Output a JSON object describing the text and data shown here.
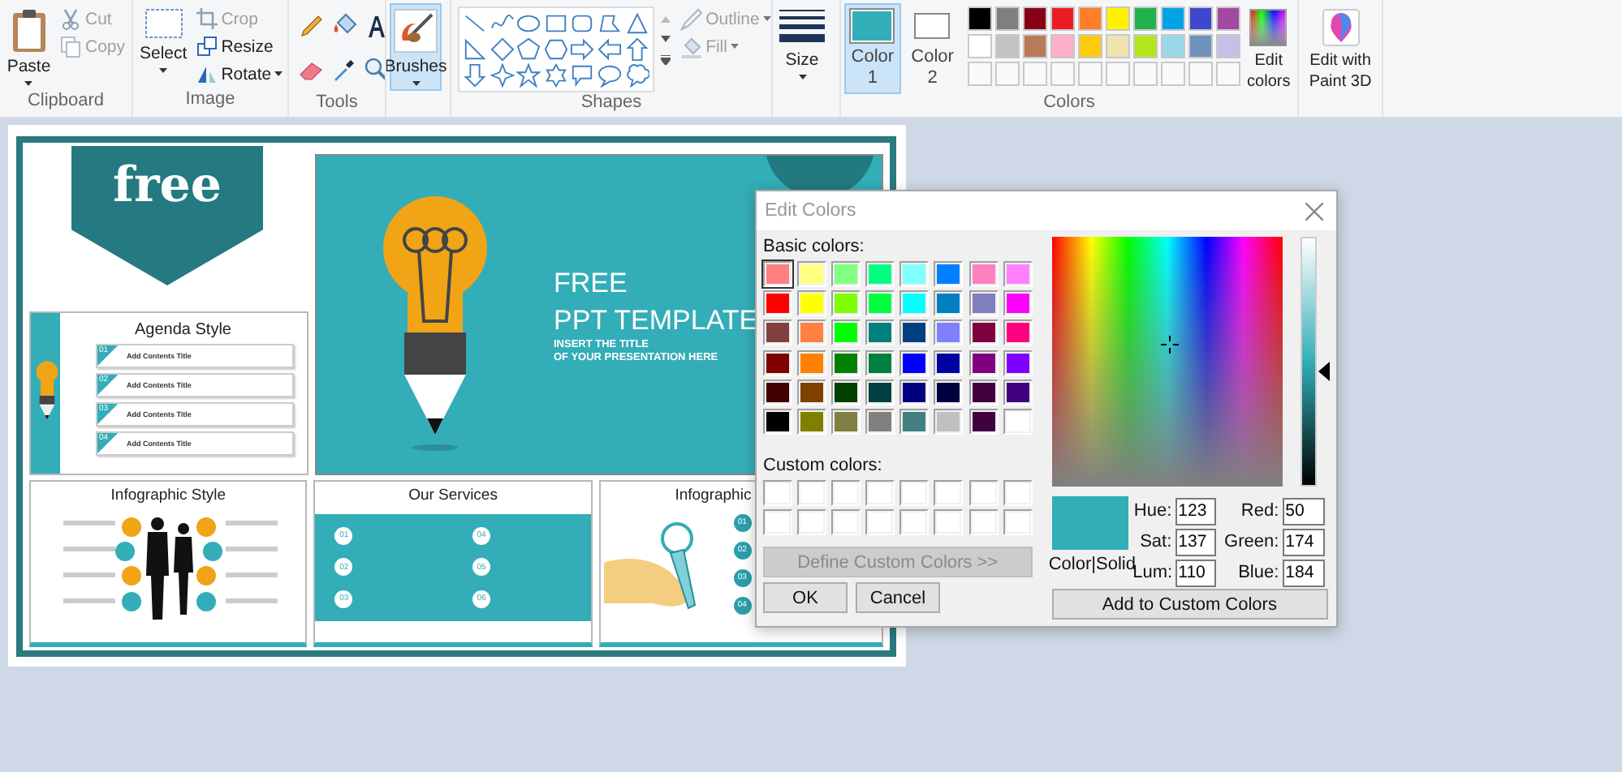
{
  "clipboard": {
    "paste": "Paste",
    "cut": {
      "label": "Cut",
      "disabled": true
    },
    "copy": {
      "label": "Copy",
      "disabled": true
    },
    "group_label": "Clipboard"
  },
  "image": {
    "select": "Select",
    "crop": {
      "label": "Crop",
      "disabled": true
    },
    "resize": {
      "label": "Resize",
      "disabled": false
    },
    "rotate": {
      "label": "Rotate",
      "disabled": false
    },
    "group_label": "Image"
  },
  "tools": {
    "group_label": "Tools"
  },
  "brushes": {
    "label": "Brushes",
    "selected": true
  },
  "shapes": {
    "outline": {
      "label": "Outline",
      "disabled": true
    },
    "fill": {
      "label": "Fill",
      "disabled": true
    },
    "group_label": "Shapes"
  },
  "size": {
    "label": "Size"
  },
  "colors": {
    "color1": {
      "label": "Color",
      "sub": "1",
      "color": "#32aeb8",
      "selected": true
    },
    "color2": {
      "label": "Color",
      "sub": "2",
      "color": "#ffffff",
      "selected": false
    },
    "palette": [
      {
        "color": "#000000"
      },
      {
        "color": "#7f7f7f"
      },
      {
        "color": "#880015"
      },
      {
        "color": "#ed1c24"
      },
      {
        "color": "#ff7f27"
      },
      {
        "color": "#fff200"
      },
      {
        "color": "#22b14c"
      },
      {
        "color": "#00a2e8"
      },
      {
        "color": "#3f48cc"
      },
      {
        "color": "#a349a4"
      },
      {
        "color": "#ffffff"
      },
      {
        "color": "#c3c3c3"
      },
      {
        "color": "#b97a57"
      },
      {
        "color": "#ffaec9"
      },
      {
        "color": "#ffc90e"
      },
      {
        "color": "#efe4b0"
      },
      {
        "color": "#b5e61d"
      },
      {
        "color": "#99d9ea"
      },
      {
        "color": "#7092be"
      },
      {
        "color": "#c8bfe7"
      }
    ],
    "edit_colors": "Edit colors",
    "group_label": "Colors"
  },
  "paint3d": {
    "label": "Edit with Paint 3D"
  },
  "canvas": {
    "banner_text": "free",
    "agenda": {
      "title": "Agenda Style",
      "items": [
        {
          "number": "01",
          "title": "Add Contents Title"
        },
        {
          "number": "02",
          "title": "Add Contents Title"
        },
        {
          "number": "03",
          "title": "Add Contents Title"
        },
        {
          "number": "04",
          "title": "Add Contents Title"
        }
      ]
    },
    "hero": {
      "line1": "FREE",
      "line2": "PPT TEMPLATE",
      "subtitle1": "INSERT THE TITLE",
      "subtitle2": "OF YOUR PRESENTATION HERE"
    },
    "infographic": {
      "title": "Infographic Style"
    },
    "services": {
      "title": "Our Services",
      "numbers": [
        "01",
        "02",
        "03",
        "04",
        "05",
        "06"
      ]
    },
    "infographic2": {
      "title": "Infographic",
      "numbers": [
        "01",
        "02",
        "03",
        "04"
      ]
    }
  },
  "dialog": {
    "title": "Edit Colors",
    "basic_colors_label": "Basic colors:",
    "basic_colors": [
      {
        "color": "#ff8080",
        "selected": true
      },
      {
        "color": "#ffff80",
        "selected": false
      },
      {
        "color": "#80ff80",
        "selected": false
      },
      {
        "color": "#00ff80",
        "selected": false
      },
      {
        "color": "#80ffff",
        "selected": false
      },
      {
        "color": "#0080ff",
        "selected": false
      },
      {
        "color": "#ff80c0",
        "selected": false
      },
      {
        "color": "#ff80ff",
        "selected": false
      },
      {
        "color": "#ff0000",
        "selected": false
      },
      {
        "color": "#ffff00",
        "selected": false
      },
      {
        "color": "#80ff00",
        "selected": false
      },
      {
        "color": "#00ff40",
        "selected": false
      },
      {
        "color": "#00ffff",
        "selected": false
      },
      {
        "color": "#0080c0",
        "selected": false
      },
      {
        "color": "#8080c0",
        "selected": false
      },
      {
        "color": "#ff00ff",
        "selected": false
      },
      {
        "color": "#804040",
        "selected": false
      },
      {
        "color": "#ff8040",
        "selected": false
      },
      {
        "color": "#00ff00",
        "selected": false
      },
      {
        "color": "#008080",
        "selected": false
      },
      {
        "color": "#004080",
        "selected": false
      },
      {
        "color": "#8080ff",
        "selected": false
      },
      {
        "color": "#800040",
        "selected": false
      },
      {
        "color": "#ff0080",
        "selected": false
      },
      {
        "color": "#800000",
        "selected": false
      },
      {
        "color": "#ff8000",
        "selected": false
      },
      {
        "color": "#008000",
        "selected": false
      },
      {
        "color": "#008040",
        "selected": false
      },
      {
        "color": "#0000ff",
        "selected": false
      },
      {
        "color": "#0000a0",
        "selected": false
      },
      {
        "color": "#800080",
        "selected": false
      },
      {
        "color": "#8000ff",
        "selected": false
      },
      {
        "color": "#400000",
        "selected": false
      },
      {
        "color": "#804000",
        "selected": false
      },
      {
        "color": "#004000",
        "selected": false
      },
      {
        "color": "#004040",
        "selected": false
      },
      {
        "color": "#000080",
        "selected": false
      },
      {
        "color": "#000040",
        "selected": false
      },
      {
        "color": "#400040",
        "selected": false
      },
      {
        "color": "#400080",
        "selected": false
      },
      {
        "color": "#000000",
        "selected": false
      },
      {
        "color": "#808000",
        "selected": false
      },
      {
        "color": "#808040",
        "selected": false
      },
      {
        "color": "#808080",
        "selected": false
      },
      {
        "color": "#408080",
        "selected": false
      },
      {
        "color": "#c0c0c0",
        "selected": false
      },
      {
        "color": "#400040",
        "selected": false
      },
      {
        "color": "#ffffff",
        "selected": false
      }
    ],
    "custom_colors_label": "Custom colors:",
    "define_button": {
      "label": "Define Custom Colors >>",
      "disabled": true
    },
    "ok": "OK",
    "cancel": "Cancel",
    "color_solid": "Color|Solid",
    "hsl_fields": [
      {
        "label": "Hue:",
        "value": "123"
      },
      {
        "label": "Sat:",
        "value": "137"
      },
      {
        "label": "Lum:",
        "value": "110"
      }
    ],
    "rgb_fields": [
      {
        "label": "Red:",
        "value": "50"
      },
      {
        "label": "Green:",
        "value": "174"
      },
      {
        "label": "Blue:",
        "value": "184"
      }
    ],
    "add_button": "Add to Custom Colors"
  }
}
